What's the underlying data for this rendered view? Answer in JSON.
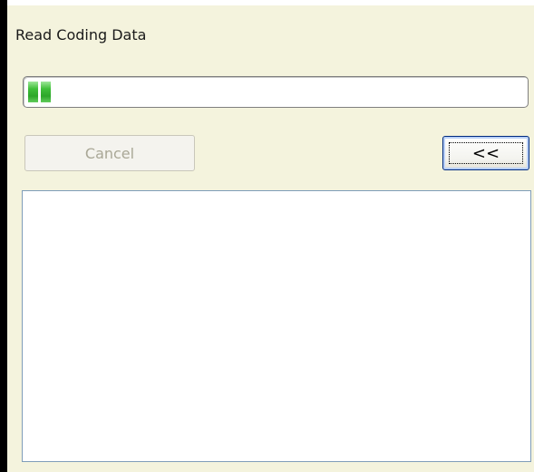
{
  "dialog": {
    "title": "Read Coding Data"
  },
  "progress": {
    "fraction": 0.05,
    "segments_filled": 2
  },
  "buttons": {
    "cancel_label": "Cancel",
    "cancel_enabled": false,
    "collapse_label": "<<"
  },
  "log": {
    "text": ""
  },
  "colors": {
    "panel_background": "#f4f3dd",
    "progress_fill": "#2da62a",
    "focus_border": "#002a7f",
    "log_border": "#7f9db9"
  }
}
